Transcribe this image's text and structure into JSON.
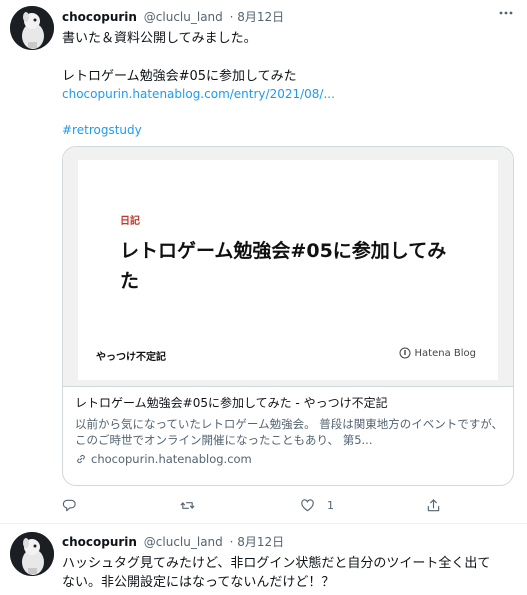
{
  "tweets": [
    {
      "user": {
        "name": "chocopurin",
        "handle": "@cluclu_land",
        "date": "8月12日"
      },
      "text_lines": [
        "書いた＆資料公開してみました。",
        "レトロゲーム勉強会#05に参加してみた"
      ],
      "link": "chocopurin.hatenablog.com/entry/2021/08/...",
      "hashtag": "#retrogstudy",
      "card": {
        "image": {
          "category": "日記",
          "title": "レトロゲーム勉強会#05に参加してみた",
          "site": "やっつけ不定記",
          "brand": "Hatena Blog"
        },
        "title": "レトロゲーム勉強会#05に参加してみた - やっつけ不定記",
        "description": "以前から気になっていたレトロゲーム勉強会。 普段は関東地方のイベントですが、このご時世でオンライン開催になったこともあり、 第5...",
        "domain": "chocopurin.hatenablog.com"
      },
      "actions": {
        "reply_count": "",
        "retweet_count": "",
        "like_count": "1"
      }
    },
    {
      "user": {
        "name": "chocopurin",
        "handle": "@cluclu_land",
        "date": "8月12日"
      },
      "text_lines": [
        "ハッシュタグ見てみたけど、非ログイン状態だと自分のツイート全く出て",
        "ない。非公開設定にはなってないんだけど！？"
      ]
    }
  ],
  "colors": {
    "link": "#1d9bf0",
    "muted": "#536471",
    "text": "#0f1419",
    "card_category": "#c0392b"
  },
  "icons": [
    "more-icon",
    "reply-icon",
    "retweet-icon",
    "like-icon",
    "share-icon",
    "link-icon",
    "hatena-icon"
  ]
}
